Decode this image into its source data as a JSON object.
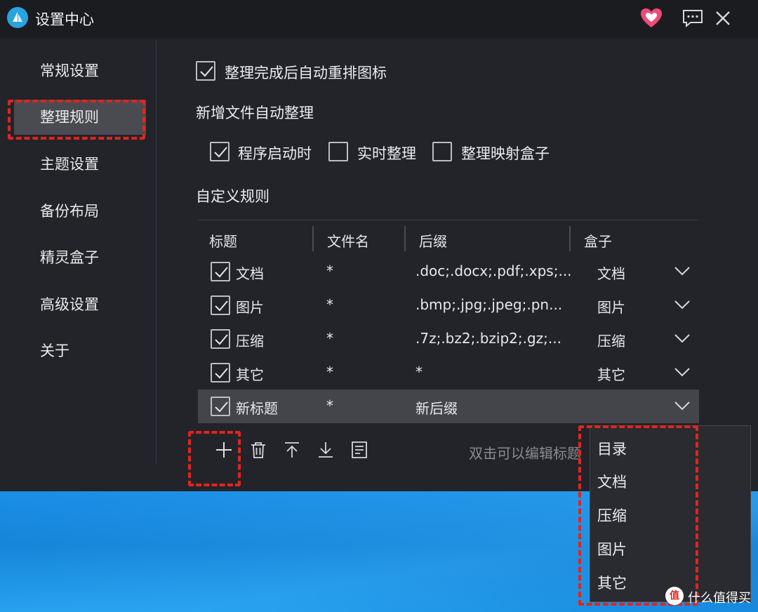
{
  "window": {
    "title": "设置中心"
  },
  "sidebar": {
    "items": [
      {
        "label": "常规设置"
      },
      {
        "label": "整理规则"
      },
      {
        "label": "主题设置"
      },
      {
        "label": "备份布局"
      },
      {
        "label": "精灵盒子"
      },
      {
        "label": "高级设置"
      },
      {
        "label": "关于"
      }
    ],
    "active_index": 1
  },
  "settings": {
    "auto_rearrange": {
      "label": "整理完成后自动重排图标",
      "checked": true
    },
    "new_file_section": "新增文件自动整理",
    "options": [
      {
        "label": "程序启动时",
        "checked": true
      },
      {
        "label": "实时整理",
        "checked": false
      },
      {
        "label": "整理映射盒子",
        "checked": false
      }
    ],
    "custom_rules_section": "自定义规则"
  },
  "table": {
    "headers": [
      "标题",
      "文件名",
      "后缀",
      "盒子"
    ],
    "rows": [
      {
        "title": "文档",
        "filename": "*",
        "suffix": ".doc;.docx;.pdf;.xps;...",
        "box": "文档",
        "checked": true
      },
      {
        "title": "图片",
        "filename": "*",
        "suffix": ".bmp;.jpg;.jpeg;.pn...",
        "box": "图片",
        "checked": true
      },
      {
        "title": "压缩",
        "filename": "*",
        "suffix": ".7z;.bz2;.bzip2;.gz;...",
        "box": "压缩",
        "checked": true
      },
      {
        "title": "其它",
        "filename": "*",
        "suffix": "*",
        "box": "其它",
        "checked": true
      },
      {
        "title": "新标题",
        "filename": "*",
        "suffix": "新后缀",
        "box": "",
        "checked": true
      }
    ],
    "selected_row": 4
  },
  "toolbar": {
    "hint": "双击可以编辑标题"
  },
  "dropdown": {
    "options": [
      "目录",
      "文档",
      "压缩",
      "图片",
      "其它"
    ]
  },
  "watermark": {
    "badge": "值",
    "text": "什么值得买"
  },
  "colors": {
    "highlight": "#e0251f",
    "heart": "#f04a7a",
    "logo": "#29a3e0"
  }
}
